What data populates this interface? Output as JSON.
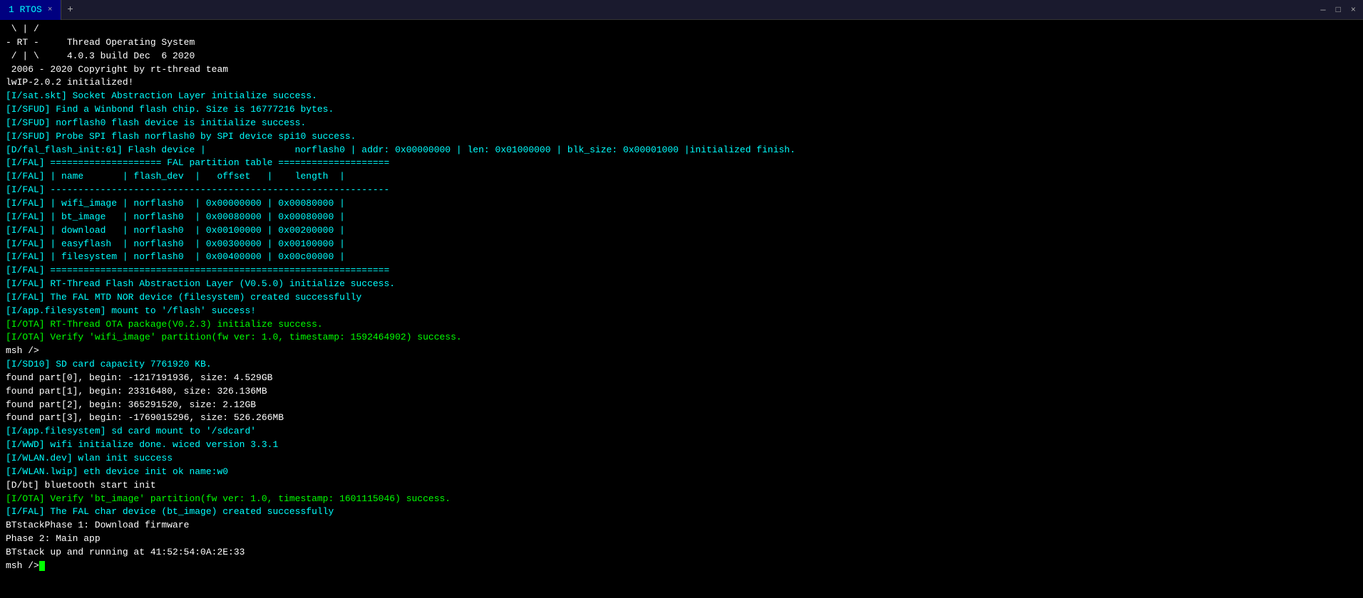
{
  "titleBar": {
    "tab": {
      "label": "1 RTOS",
      "close": "×"
    },
    "addTab": "+",
    "controls": {
      "minimize": "—",
      "maximize": "□",
      "close": "×"
    }
  },
  "terminal": {
    "lines": [
      {
        "text": " \\ | /",
        "color": "white"
      },
      {
        "text": "- RT -     Thread Operating System",
        "color": "white"
      },
      {
        "text": " / | \\     4.0.3 build Dec  6 2020",
        "color": "white"
      },
      {
        "text": " 2006 - 2020 Copyright by rt-thread team",
        "color": "white"
      },
      {
        "text": "lwIP-2.0.2 initialized!",
        "color": "white"
      },
      {
        "text": "[I/sat.skt] Socket Abstraction Layer initialize success.",
        "color": "cyan"
      },
      {
        "text": "[I/SFUD] Find a Winbond flash chip. Size is 16777216 bytes.",
        "color": "cyan"
      },
      {
        "text": "[I/SFUD] norflash0 flash device is initialize success.",
        "color": "cyan"
      },
      {
        "text": "[I/SFUD] Probe SPI flash norflash0 by SPI device spi10 success.",
        "color": "cyan"
      },
      {
        "text": "[D/fal_flash_init:61] Flash device |                norflash0 | addr: 0x00000000 | len: 0x01000000 | blk_size: 0x00001000 |initialized finish.",
        "color": "cyan"
      },
      {
        "text": "[I/FAL] ==================== FAL partition table ====================",
        "color": "cyan"
      },
      {
        "text": "[I/FAL] | name       | flash_dev  |   offset   |    length  |",
        "color": "cyan"
      },
      {
        "text": "[I/FAL] -------------------------------------------------------------",
        "color": "cyan"
      },
      {
        "text": "[I/FAL] | wifi_image | norflash0  | 0x00000000 | 0x00080000 |",
        "color": "cyan"
      },
      {
        "text": "[I/FAL] | bt_image   | norflash0  | 0x00080000 | 0x00080000 |",
        "color": "cyan"
      },
      {
        "text": "[I/FAL] | download   | norflash0  | 0x00100000 | 0x00200000 |",
        "color": "cyan"
      },
      {
        "text": "[I/FAL] | easyflash  | norflash0  | 0x00300000 | 0x00100000 |",
        "color": "cyan"
      },
      {
        "text": "[I/FAL] | filesystem | norflash0  | 0x00400000 | 0x00c00000 |",
        "color": "cyan"
      },
      {
        "text": "[I/FAL] =============================================================",
        "color": "cyan"
      },
      {
        "text": "[I/FAL] RT-Thread Flash Abstraction Layer (V0.5.0) initialize success.",
        "color": "cyan"
      },
      {
        "text": "[I/FAL] The FAL MTD NOR device (filesystem) created successfully",
        "color": "cyan"
      },
      {
        "text": "[I/app.filesystem] mount to '/flash' success!",
        "color": "cyan"
      },
      {
        "text": "[I/OTA] RT-Thread OTA package(V0.2.3) initialize success.",
        "color": "green"
      },
      {
        "text": "[I/OTA] Verify 'wifi_image' partition(fw ver: 1.0, timestamp: 1592464902) success.",
        "color": "green"
      },
      {
        "text": "msh />",
        "color": "white"
      },
      {
        "text": "[I/SD10] SD card capacity 7761920 KB.",
        "color": "cyan"
      },
      {
        "text": "found part[0], begin: -1217191936, size: 4.529GB",
        "color": "white"
      },
      {
        "text": "found part[1], begin: 23316480, size: 326.136MB",
        "color": "white"
      },
      {
        "text": "found part[2], begin: 365291520, size: 2.12GB",
        "color": "white"
      },
      {
        "text": "found part[3], begin: -1769015296, size: 526.266MB",
        "color": "white"
      },
      {
        "text": "[I/app.filesystem] sd card mount to '/sdcard'",
        "color": "cyan"
      },
      {
        "text": "[I/WWD] wifi initialize done. wiced version 3.3.1",
        "color": "cyan"
      },
      {
        "text": "[I/WLAN.dev] wlan init success",
        "color": "cyan"
      },
      {
        "text": "[I/WLAN.lwip] eth device init ok name:w0",
        "color": "cyan"
      },
      {
        "text": "[D/bt] bluetooth start init",
        "color": "white"
      },
      {
        "text": "[I/OTA] Verify 'bt_image' partition(fw ver: 1.0, timestamp: 1601115046) success.",
        "color": "green"
      },
      {
        "text": "[I/FAL] The FAL char device (bt_image) created successfully",
        "color": "cyan"
      },
      {
        "text": "BTstackPhase 1: Download firmware",
        "color": "white"
      },
      {
        "text": "Phase 2: Main app",
        "color": "white"
      },
      {
        "text": "BTstack up and running at 41:52:54:0A:2E:33",
        "color": "white"
      },
      {
        "text": "",
        "color": "white"
      },
      {
        "text": "msh />",
        "color": "white",
        "cursor": true
      }
    ]
  }
}
